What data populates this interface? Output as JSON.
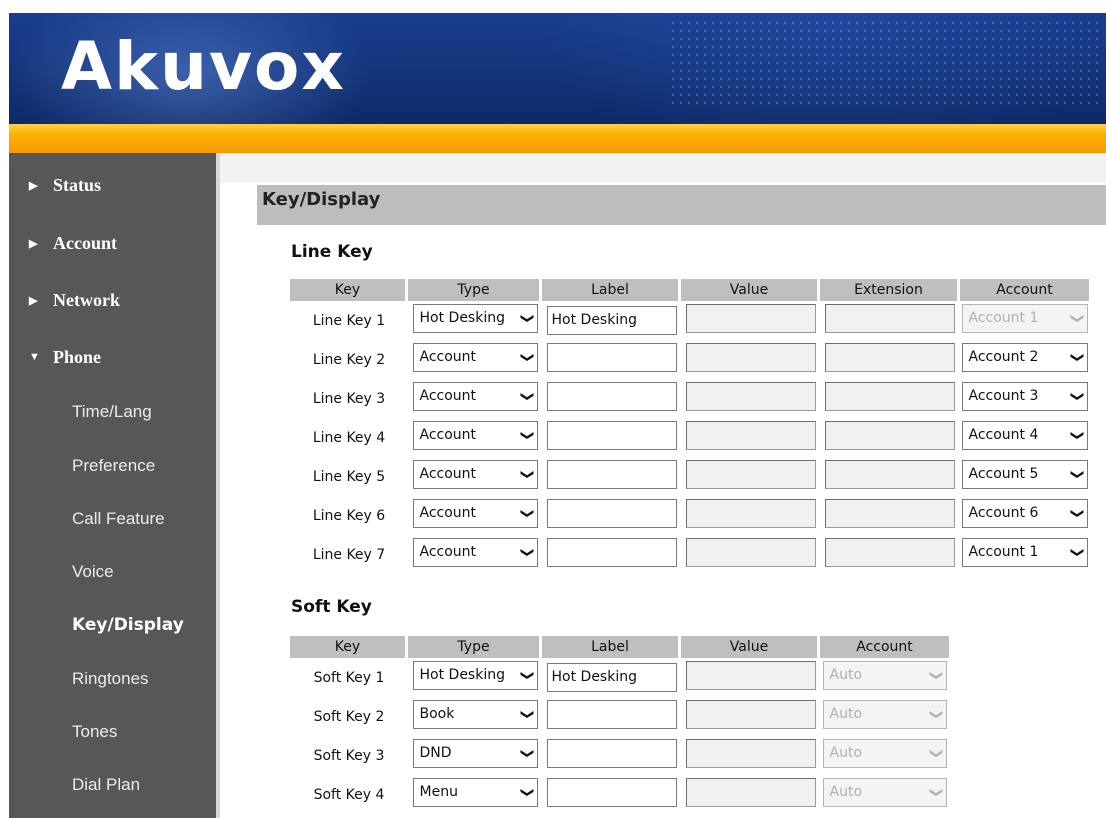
{
  "header": {
    "logo_text": "Akuvox"
  },
  "sidebar": {
    "status": "Status",
    "account": "Account",
    "network": "Network",
    "phone": "Phone",
    "sub_items": [
      "Time/Lang",
      "Preference",
      "Call Feature",
      "Voice",
      "Key/Display",
      "Ringtones",
      "Tones",
      "Dial Plan"
    ],
    "active": "Key/Display"
  },
  "main": {
    "page_title": "Key/Display",
    "line_key": {
      "title": "Line Key",
      "headers": [
        "Key",
        "Type",
        "Label",
        "Value",
        "Extension",
        "Account"
      ],
      "rows": [
        {
          "key": "Line Key 1",
          "type": "Hot Desking",
          "label": "Hot Desking",
          "value": "",
          "extension": "",
          "account": "Account 1",
          "account_disabled": true
        },
        {
          "key": "Line Key 2",
          "type": "Account",
          "label": "",
          "value": "",
          "extension": "",
          "account": "Account 2",
          "account_disabled": false
        },
        {
          "key": "Line Key 3",
          "type": "Account",
          "label": "",
          "value": "",
          "extension": "",
          "account": "Account 3",
          "account_disabled": false
        },
        {
          "key": "Line Key 4",
          "type": "Account",
          "label": "",
          "value": "",
          "extension": "",
          "account": "Account 4",
          "account_disabled": false
        },
        {
          "key": "Line Key 5",
          "type": "Account",
          "label": "",
          "value": "",
          "extension": "",
          "account": "Account 5",
          "account_disabled": false
        },
        {
          "key": "Line Key 6",
          "type": "Account",
          "label": "",
          "value": "",
          "extension": "",
          "account": "Account 6",
          "account_disabled": false
        },
        {
          "key": "Line Key 7",
          "type": "Account",
          "label": "",
          "value": "",
          "extension": "",
          "account": "Account 1",
          "account_disabled": false
        }
      ]
    },
    "soft_key": {
      "title": "Soft Key",
      "headers": [
        "Key",
        "Type",
        "Label",
        "Value",
        "Account"
      ],
      "rows": [
        {
          "key": "Soft Key 1",
          "type": "Hot Desking",
          "label": "Hot Desking",
          "value": "",
          "account": "Auto"
        },
        {
          "key": "Soft Key 2",
          "type": "Book",
          "label": "",
          "value": "",
          "account": "Auto"
        },
        {
          "key": "Soft Key 3",
          "type": "DND",
          "label": "",
          "value": "",
          "account": "Auto"
        },
        {
          "key": "Soft Key 4",
          "type": "Menu",
          "label": "",
          "value": "",
          "account": "Auto"
        }
      ]
    }
  },
  "colors": {
    "header_blue": "#143479",
    "accent_orange": "#ffb000",
    "sidebar_gray": "#555759",
    "table_header_gray": "#bfbfbf"
  }
}
